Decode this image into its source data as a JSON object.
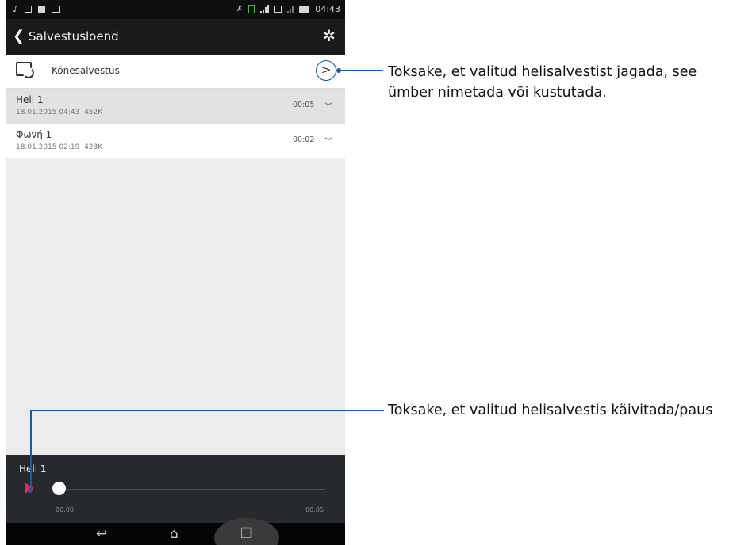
{
  "status_bar": {
    "left_icons": [
      "music-note-icon",
      "calendar-icon",
      "document-icon",
      "photo-icon"
    ],
    "right_icons": [
      "mute-icon",
      "sim-icon",
      "signal-icon",
      "sim-2-icon",
      "signal-weak-icon",
      "battery-icon"
    ],
    "time": "04:43"
  },
  "app_bar": {
    "back_icon": "chevron-left-icon",
    "title": "Salvestusloend",
    "settings_icon": "gear-icon"
  },
  "call_recording_row": {
    "icon": "call-recording-folder-icon",
    "label": "Kõnesalvestus",
    "arrow_icon": "chevron-right-icon"
  },
  "recordings": [
    {
      "name": "Heli 1",
      "date": "18.01.2015 04:43",
      "size": "452K",
      "duration": "00:05",
      "selected": true
    },
    {
      "name": "Φωνή 1",
      "date": "18.01.2015 02:19",
      "size": "423K",
      "duration": "00:02",
      "selected": false
    }
  ],
  "player": {
    "title": "Heli 1",
    "current_time": "00:00",
    "total_time": "00:05",
    "progress": 0
  },
  "nav_bar": {
    "buttons": [
      "back-icon",
      "home-icon",
      "recent-apps-icon"
    ]
  },
  "callouts": {
    "share_line1": "Toksake, et valitud helisalvestist jagada, see",
    "share_line2": "ümber nimetada või kustutada.",
    "play_text": "Toksake, et valitud helisalvestis käivitada/paus"
  },
  "colors": {
    "accent_callout": "#1a5aa8",
    "play_button": "#e8294f",
    "selected_row": "#e2e2e2"
  }
}
